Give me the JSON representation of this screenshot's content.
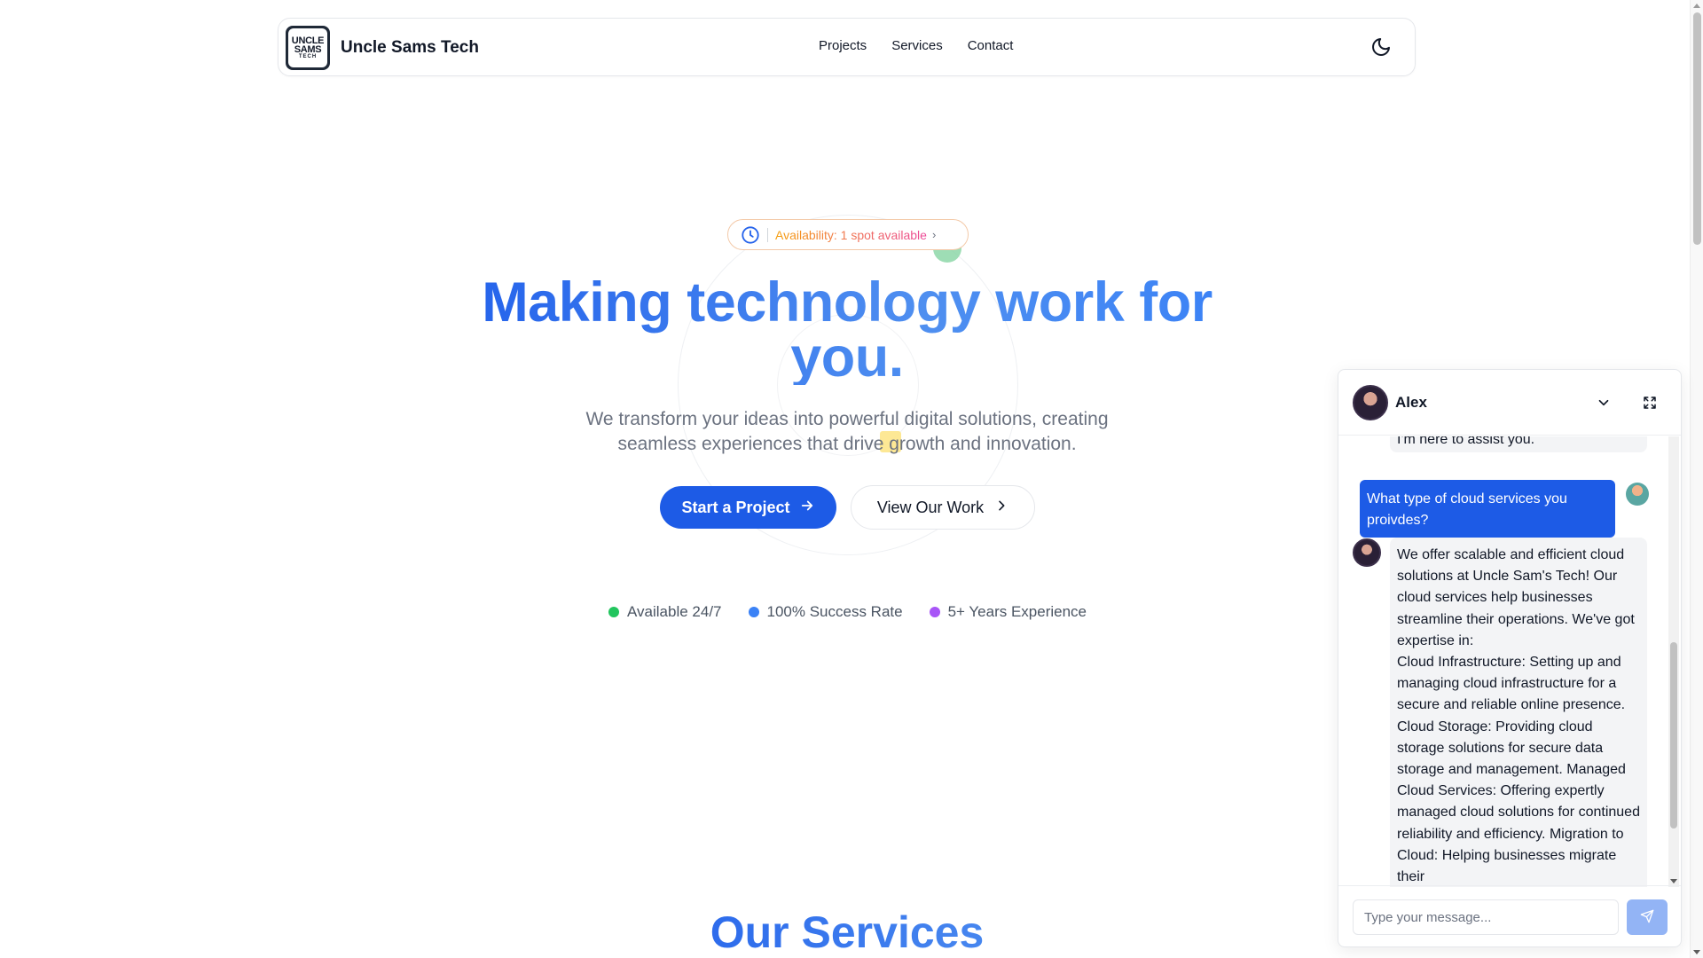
{
  "navbar": {
    "logo": {
      "line1": "UNCLE",
      "line2": "SAMS",
      "line3": "TECH"
    },
    "brand_name": "Uncle Sams Tech",
    "links": [
      "Projects",
      "Services",
      "Contact"
    ],
    "theme_toggle_icon": "moon-icon"
  },
  "hero": {
    "availability": "Availability: 1 spot available",
    "title": "Making technology work for you.",
    "subtitle": "We transform your ideas into powerful digital solutions, creating seamless experiences that drive growth and innovation.",
    "primary_button": "Start a Project",
    "secondary_button": "View Our Work",
    "stats": [
      {
        "label": "Available 24/7",
        "color": "#22c55e"
      },
      {
        "label": "100% Success Rate",
        "color": "#3b82f6"
      },
      {
        "label": "5+ Years Experience",
        "color": "#a855f7"
      }
    ]
  },
  "services": {
    "heading": "Our Services"
  },
  "chat": {
    "agent_name": "Alex",
    "previous_message": "I'm here to assist you.",
    "user_message": "What type of cloud services you proivdes?",
    "bot_message": "We offer scalable and efficient cloud solutions at Uncle Sam's Tech! Our cloud services help businesses streamline their operations. We've got expertise in:",
    "bot_message_detail": "Cloud Infrastructure: Setting up and managing cloud infrastructure for a secure and reliable online presence. Cloud Storage: Providing cloud storage solutions for secure data storage and management. Managed Cloud Services: Offering expertly managed cloud solutions for continued reliability and efficiency. Migration to Cloud: Helping businesses migrate their",
    "input_placeholder": "Type your message...",
    "accent_color": "#1d5be6"
  }
}
